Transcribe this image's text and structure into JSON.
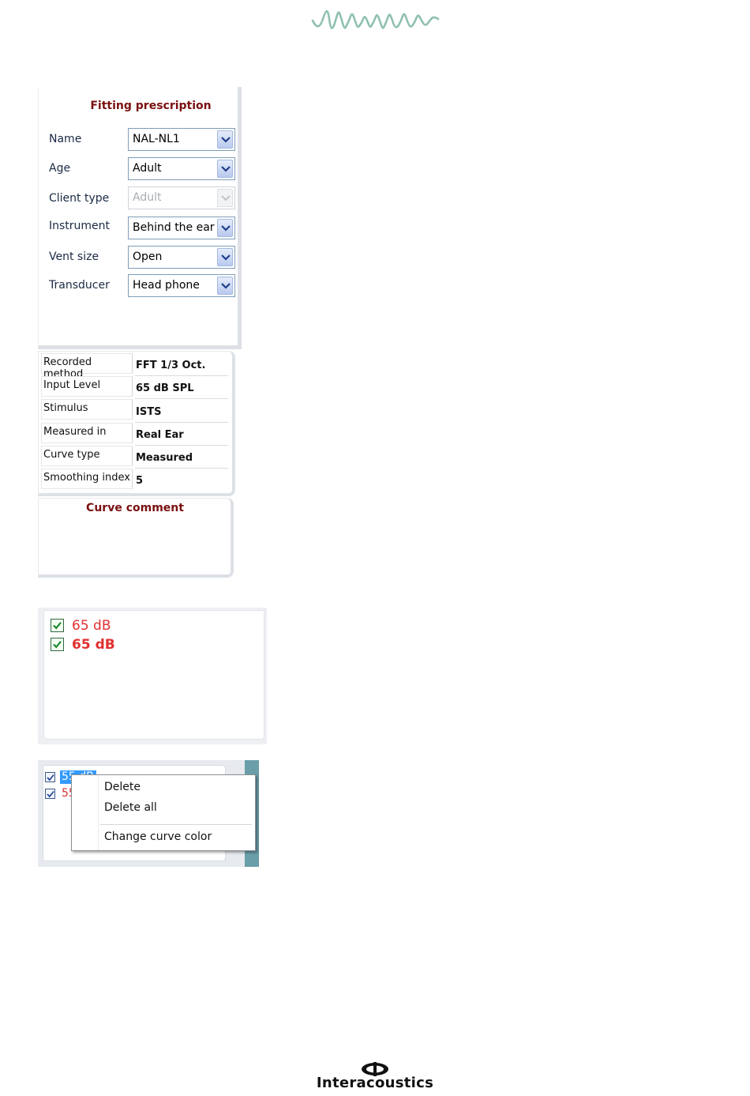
{
  "fitting_prescription": {
    "title": "Fitting prescription",
    "fields": [
      {
        "label": "Name",
        "value": "NAL-NL1",
        "enabled": true
      },
      {
        "label": "Age",
        "value": "Adult",
        "enabled": true
      },
      {
        "label": "Client type",
        "value": "Adult",
        "enabled": false
      },
      {
        "label": "Instrument",
        "value": "Behind the ear",
        "enabled": true
      },
      {
        "label": "Vent size",
        "value": "Open",
        "enabled": true
      },
      {
        "label": "Transducer",
        "value": "Head phone",
        "enabled": true
      }
    ]
  },
  "curve_info": {
    "rows": [
      {
        "label": "Recorded method",
        "value": "FFT 1/3 Oct."
      },
      {
        "label": "Input Level",
        "value": "65 dB SPL"
      },
      {
        "label": "Stimulus",
        "value": "ISTS"
      },
      {
        "label": "Measured in",
        "value": "Real Ear"
      },
      {
        "label": "Curve type",
        "value": "Measured"
      },
      {
        "label": "Smoothing index",
        "value": "5"
      }
    ]
  },
  "curve_comment": {
    "title": "Curve comment",
    "text": ""
  },
  "curve_list": {
    "items": [
      {
        "label": "65 dB",
        "checked": true,
        "bold": false
      },
      {
        "label": "65 dB",
        "checked": true,
        "bold": true
      }
    ],
    "label_color": "#e03030"
  },
  "context_menu_example": {
    "list_items": [
      {
        "label": "55 dB",
        "checked": true,
        "selected": true
      },
      {
        "label": "55",
        "checked": true,
        "selected": false
      }
    ],
    "menu": {
      "delete": "Delete",
      "delete_all": "Delete all",
      "change_color": "Change curve color"
    },
    "selection_color": "#3399ff"
  },
  "footer": {
    "brand": "Interacoustics"
  },
  "colors": {
    "title_red": "#7a1010",
    "wave_green": "#8fc0b0"
  }
}
